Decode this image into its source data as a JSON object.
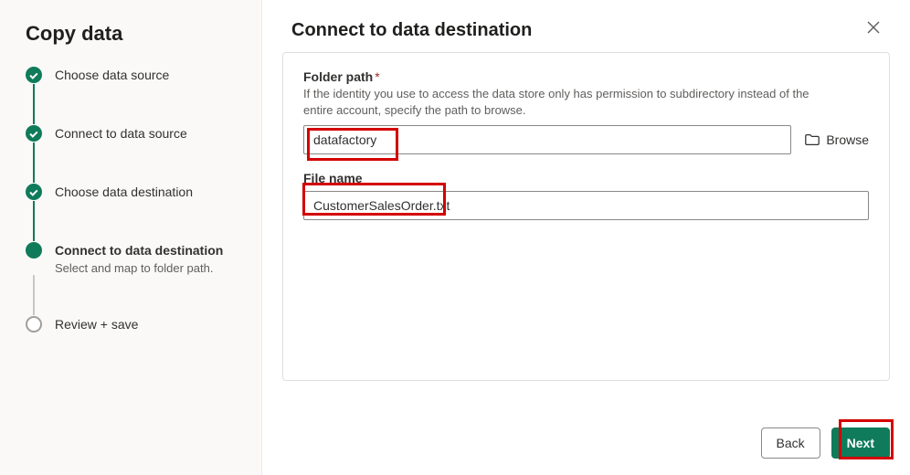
{
  "wizard": {
    "title": "Copy data",
    "steps": [
      {
        "label": "Choose data source",
        "state": "done"
      },
      {
        "label": "Connect to data source",
        "state": "done"
      },
      {
        "label": "Choose data destination",
        "state": "done"
      },
      {
        "label": "Connect to data destination",
        "state": "current",
        "sub": "Select and map to folder path."
      },
      {
        "label": "Review + save",
        "state": "future"
      }
    ]
  },
  "main": {
    "title": "Connect to data destination",
    "folder": {
      "label": "Folder path",
      "required": "*",
      "help": "If the identity you use to access the data store only has permission to subdirectory instead of the entire account, specify the path to browse.",
      "value": "datafactory",
      "browse": "Browse"
    },
    "file": {
      "label": "File name",
      "value": "CustomerSalesOrder.txt"
    }
  },
  "footer": {
    "back": "Back",
    "next": "Next"
  }
}
